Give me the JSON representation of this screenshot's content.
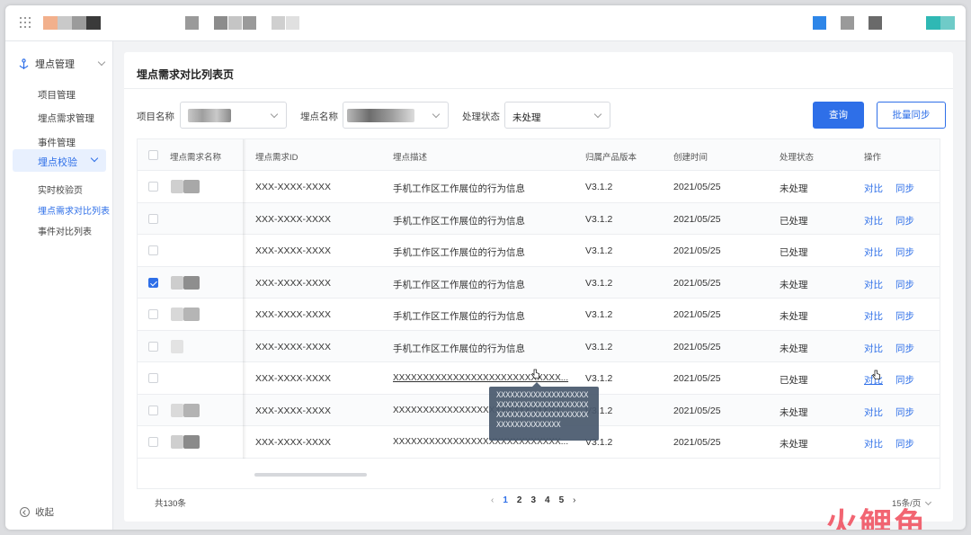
{
  "sidebar": {
    "group_label": "埋点管理",
    "items": [
      "项目管理",
      "埋点需求管理",
      "事件管理"
    ],
    "active_group": "埋点校验",
    "sub_items": [
      "实时校验页",
      "埋点需求对比列表",
      "事件对比列表"
    ],
    "active_sub_index": 1,
    "collapse_label": "收起"
  },
  "page": {
    "title": "埋点需求对比列表页"
  },
  "filters": {
    "project_label": "项目名称",
    "point_label": "埋点名称",
    "status_label": "处理状态",
    "status_value": "未处理",
    "query_button": "查询",
    "batch_button": "批量同步"
  },
  "table": {
    "headers": [
      "埋点需求名称",
      "埋点需求ID",
      "埋点描述",
      "归属产品版本",
      "创建时间",
      "处理状态",
      "操作"
    ],
    "rows": [
      {
        "checked": false,
        "id": "XXX-XXXX-XXXX",
        "desc": "手机工作区工作展位的行为信息",
        "version": "V3.1.2",
        "created": "2021/05/25",
        "status": "未处理"
      },
      {
        "checked": false,
        "id": "XXX-XXXX-XXXX",
        "desc": "手机工作区工作展位的行为信息",
        "version": "V3.1.2",
        "created": "2021/05/25",
        "status": "已处理"
      },
      {
        "checked": false,
        "id": "XXX-XXXX-XXXX",
        "desc": "手机工作区工作展位的行为信息",
        "version": "V3.1.2",
        "created": "2021/05/25",
        "status": "已处理"
      },
      {
        "checked": true,
        "id": "XXX-XXXX-XXXX",
        "desc": "手机工作区工作展位的行为信息",
        "version": "V3.1.2",
        "created": "2021/05/25",
        "status": "未处理"
      },
      {
        "checked": false,
        "id": "XXX-XXXX-XXXX",
        "desc": "手机工作区工作展位的行为信息",
        "version": "V3.1.2",
        "created": "2021/05/25",
        "status": "未处理"
      },
      {
        "checked": false,
        "id": "XXX-XXXX-XXXX",
        "desc": "手机工作区工作展位的行为信息",
        "version": "V3.1.2",
        "created": "2021/05/25",
        "status": "未处理"
      },
      {
        "checked": false,
        "id": "XXX-XXXX-XXXX",
        "desc": "XXXXXXXXXXXXXXXXXXXXXXXXXXXX...",
        "version": "V3.1.2",
        "created": "2021/05/25",
        "status": "已处理"
      },
      {
        "checked": false,
        "id": "XXX-XXXX-XXXX",
        "desc": "XXXXXXXXXXXXXXXXXXXXXXXXXXXX...",
        "version": "V3.1.2",
        "created": "2021/05/25",
        "status": "未处理"
      },
      {
        "checked": false,
        "id": "XXX-XXXX-XXXX",
        "desc": "XXXXXXXXXXXXXXXXXXXXXXXXXXXX...",
        "version": "V3.1.2",
        "created": "2021/05/25",
        "status": "未处理"
      }
    ],
    "actions": {
      "compare": "对比",
      "sync": "同步"
    }
  },
  "tooltip": {
    "text": "XXXXXXXXXXXXXXXXXXXXXXXXXXXXXXXXXXXXXXXXXXXXXXXXXXXXXXXXXXXXXXXXXXXXXXXXXX"
  },
  "pagination": {
    "total": "共130条",
    "pages": [
      "1",
      "2",
      "3",
      "4",
      "5"
    ],
    "current": "1",
    "page_size": "15条/页"
  },
  "watermark": {
    "text": "火鲤鱼"
  },
  "colors": {
    "accent": "#2e6fe8",
    "tooltip_bg": "#4a5a6e"
  }
}
